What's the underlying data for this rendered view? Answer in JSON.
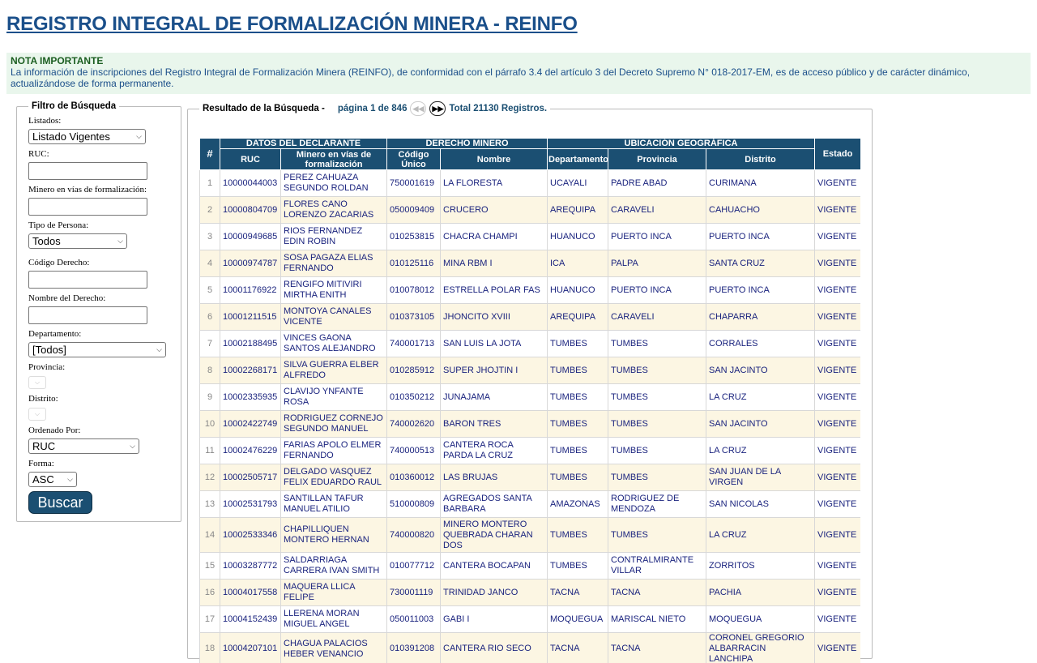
{
  "page": {
    "title": "REGISTRO INTEGRAL DE FORMALIZACIÓN MINERA - REINFO"
  },
  "nota": {
    "heading": "NOTA IMPORTANTE",
    "text": "La información de inscripciones del Registro Integral de Formalización Minera (REINFO), de conformidad con el párrafo 3.4 del artículo 3 del Decreto Supremo N° 018-2017-EM, es de acceso público y de carácter dinámico, actualizándose de forma permanente."
  },
  "filter": {
    "legend": "Filtro de Búsqueda",
    "listados_label": "Listados:",
    "listados_value": "Listado Vigentes",
    "ruc_label": "RUC:",
    "minero_label": "Minero en vías de formalización:",
    "tipo_label": "Tipo de Persona:",
    "tipo_value": "Todos",
    "codigo_label": "Código Derecho:",
    "nombre_label": "Nombre del Derecho:",
    "departamento_label": "Departamento:",
    "departamento_value": "[Todos]",
    "provincia_label": "Provincia:",
    "distrito_label": "Distrito:",
    "ordenado_label": "Ordenado Por:",
    "ordenado_value": "RUC",
    "forma_label": "Forma:",
    "forma_value": "ASC",
    "buscar_label": "Buscar"
  },
  "result": {
    "legend": "Resultado de la Búsqueda -",
    "pagina_text": "página 1 de  846",
    "total_text": "Total 21130 Registros.",
    "group_headers": {
      "declarante": "DATOS DEL DECLARANTE",
      "derecho": "DERECHO MINERO",
      "ubicacion": "UBICACIÓN GEOGRÁFICA"
    },
    "columns": {
      "num": "#",
      "ruc": "RUC",
      "minero": "Minero en vías de formalización",
      "codigo": "Código Único",
      "nombre": "Nombre",
      "departamento": "Departamento",
      "provincia": "Provincia",
      "distrito": "Distrito",
      "estado": "Estado"
    },
    "rows": [
      {
        "n": "1",
        "ruc": "10000044003",
        "minero": "PEREZ CAHUAZA SEGUNDO ROLDAN",
        "codigo": "750001619",
        "nombre": "LA FLORESTA",
        "dep": "UCAYALI",
        "prov": "PADRE ABAD",
        "dist": "CURIMANA",
        "estado": "VIGENTE"
      },
      {
        "n": "2",
        "ruc": "10000804709",
        "minero": "FLORES CANO LORENZO ZACARIAS",
        "codigo": "050009409",
        "nombre": "CRUCERO",
        "dep": "AREQUIPA",
        "prov": "CARAVELI",
        "dist": "CAHUACHO",
        "estado": "VIGENTE"
      },
      {
        "n": "3",
        "ruc": "10000949685",
        "minero": "RIOS FERNANDEZ EDIN ROBIN",
        "codigo": "010253815",
        "nombre": "CHACRA CHAMPI",
        "dep": "HUANUCO",
        "prov": "PUERTO INCA",
        "dist": "PUERTO INCA",
        "estado": "VIGENTE"
      },
      {
        "n": "4",
        "ruc": "10000974787",
        "minero": "SOSA PAGAZA ELIAS FERNANDO",
        "codigo": "010125116",
        "nombre": "MINA RBM I",
        "dep": "ICA",
        "prov": "PALPA",
        "dist": "SANTA CRUZ",
        "estado": "VIGENTE"
      },
      {
        "n": "5",
        "ruc": "10001176922",
        "minero": "RENGIFO MITIVIRI MIRTHA ENITH",
        "codigo": "010078012",
        "nombre": "ESTRELLA POLAR FAS",
        "dep": "HUANUCO",
        "prov": "PUERTO INCA",
        "dist": "PUERTO INCA",
        "estado": "VIGENTE"
      },
      {
        "n": "6",
        "ruc": "10001211515",
        "minero": "MONTOYA CANALES VICENTE",
        "codigo": "010373105",
        "nombre": "JHONCITO XVIII",
        "dep": "AREQUIPA",
        "prov": "CARAVELI",
        "dist": "CHAPARRA",
        "estado": "VIGENTE"
      },
      {
        "n": "7",
        "ruc": "10002188495",
        "minero": "VINCES GAONA SANTOS ALEJANDRO",
        "codigo": "740001713",
        "nombre": "SAN LUIS LA JOTA",
        "dep": "TUMBES",
        "prov": "TUMBES",
        "dist": "CORRALES",
        "estado": "VIGENTE"
      },
      {
        "n": "8",
        "ruc": "10002268171",
        "minero": "SILVA GUERRA ELBER ALFREDO",
        "codigo": "010285912",
        "nombre": "SUPER JHOJTIN I",
        "dep": "TUMBES",
        "prov": "TUMBES",
        "dist": "SAN JACINTO",
        "estado": "VIGENTE"
      },
      {
        "n": "9",
        "ruc": "10002335935",
        "minero": "CLAVIJO YNFANTE ROSA",
        "codigo": "010350212",
        "nombre": "JUNAJAMA",
        "dep": "TUMBES",
        "prov": "TUMBES",
        "dist": "LA CRUZ",
        "estado": "VIGENTE"
      },
      {
        "n": "10",
        "ruc": "10002422749",
        "minero": "RODRIGUEZ CORNEJO SEGUNDO MANUEL",
        "codigo": "740002620",
        "nombre": "BARON TRES",
        "dep": "TUMBES",
        "prov": "TUMBES",
        "dist": "SAN JACINTO",
        "estado": "VIGENTE"
      },
      {
        "n": "11",
        "ruc": "10002476229",
        "minero": "FARIAS APOLO ELMER FERNANDO",
        "codigo": "740000513",
        "nombre": "CANTERA ROCA PARDA LA CRUZ",
        "dep": "TUMBES",
        "prov": "TUMBES",
        "dist": "LA CRUZ",
        "estado": "VIGENTE"
      },
      {
        "n": "12",
        "ruc": "10002505717",
        "minero": "DELGADO VASQUEZ FELIX EDUARDO RAUL",
        "codigo": "010360012",
        "nombre": "LAS BRUJAS",
        "dep": "TUMBES",
        "prov": "TUMBES",
        "dist": "SAN JUAN DE LA VIRGEN",
        "estado": "VIGENTE"
      },
      {
        "n": "13",
        "ruc": "10002531793",
        "minero": "SANTILLAN TAFUR MANUEL ATILIO",
        "codigo": "510000809",
        "nombre": "AGREGADOS SANTA BARBARA",
        "dep": "AMAZONAS",
        "prov": "RODRIGUEZ DE MENDOZA",
        "dist": "SAN NICOLAS",
        "estado": "VIGENTE"
      },
      {
        "n": "14",
        "ruc": "10002533346",
        "minero": "CHAPILLIQUEN MONTERO HERNAN",
        "codigo": "740000820",
        "nombre": "MINERO MONTERO QUEBRADA CHARAN DOS",
        "dep": "TUMBES",
        "prov": "TUMBES",
        "dist": "LA CRUZ",
        "estado": "VIGENTE"
      },
      {
        "n": "15",
        "ruc": "10003287772",
        "minero": "SALDARRIAGA CARRERA IVAN SMITH",
        "codigo": "010077712",
        "nombre": "CANTERA BOCAPAN",
        "dep": "TUMBES",
        "prov": "CONTRALMIRANTE VILLAR",
        "dist": "ZORRITOS",
        "estado": "VIGENTE"
      },
      {
        "n": "16",
        "ruc": "10004017558",
        "minero": "MAQUERA LLICA FELIPE",
        "codigo": "730001119",
        "nombre": "TRINIDAD JANCO",
        "dep": "TACNA",
        "prov": "TACNA",
        "dist": "PACHIA",
        "estado": "VIGENTE"
      },
      {
        "n": "17",
        "ruc": "10004152439",
        "minero": "LLERENA MORAN MIGUEL ANGEL",
        "codigo": "050011003",
        "nombre": "GABI I",
        "dep": "MOQUEGUA",
        "prov": "MARISCAL NIETO",
        "dist": "MOQUEGUA",
        "estado": "VIGENTE"
      },
      {
        "n": "18",
        "ruc": "10004207101",
        "minero": "CHAGUA PALACIOS HEBER VENANCIO",
        "codigo": "010391208",
        "nombre": "CANTERA RIO SECO",
        "dep": "TACNA",
        "prov": "TACNA",
        "dist": "CORONEL GREGORIO ALBARRACIN LANCHIPA",
        "estado": "VIGENTE"
      }
    ]
  }
}
